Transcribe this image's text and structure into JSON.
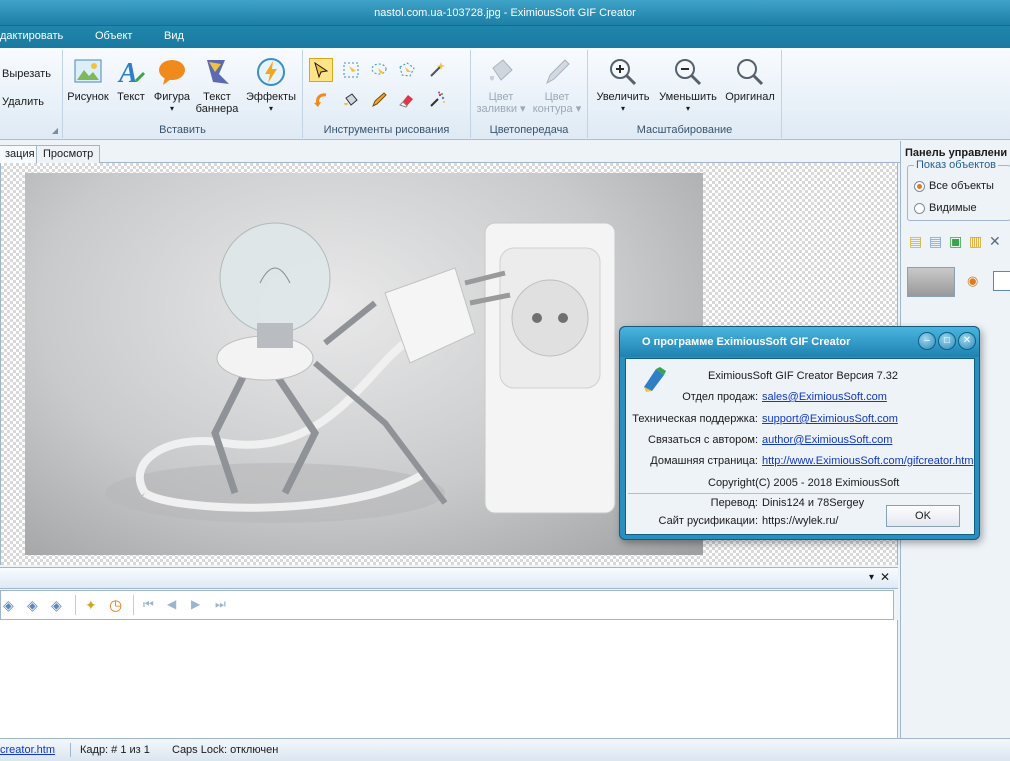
{
  "window": {
    "title": "nastol.com.ua-103728.jpg - EximiousSoft GIF Creator"
  },
  "menu": {
    "items": [
      "дактировать",
      "Объект",
      "Вид"
    ]
  },
  "ribbon": {
    "clipboard": {
      "cut": "Вырезать",
      "delete": "Удалить"
    },
    "insert": {
      "label": "Вставить",
      "picture": "Рисунок",
      "text": "Текст",
      "shape": "Фигура",
      "banner_line1": "Текст",
      "banner_line2": "баннера",
      "effects": "Эффекты"
    },
    "drawing": {
      "label": "Инструменты рисования"
    },
    "color": {
      "label": "Цветопередача",
      "fill_line1": "Цвет",
      "fill_line2": "заливки",
      "stroke_line1": "Цвет",
      "stroke_line2": "контура"
    },
    "zoom": {
      "label": "Масштабирование",
      "zoom_in": "Увеличить",
      "zoom_out": "Уменьшить",
      "original": "Оригинал"
    }
  },
  "tabs": [
    "зация",
    "Просмотр"
  ],
  "right_panel": {
    "title": "Панель управлени",
    "legend": "Показ объектов",
    "all_objects": "Все объекты",
    "visible": "Видимые"
  },
  "dialog": {
    "title": "О программе EximiousSoft GIF Creator",
    "version_line": "EximiousSoft GIF Creator Версия  7.32",
    "sales_label": "Отдел продаж:",
    "sales_email": "sales@EximiousSoft.com",
    "support_label": "Техническая поддержка:",
    "support_email": "support@EximiousSoft.com",
    "author_label": "Связаться с автором:",
    "author_email": "author@EximiousSoft.com",
    "home_label": "Домашняя страница:",
    "home_url": "http://www.EximiousSoft.com/gifcreator.htm",
    "copyright": "Copyright(C) 2005 - 2018  EximiousSoft",
    "translation_label": "Перевод:",
    "translation_value": "Dinis124 и 78Sergey",
    "ru_site_label": "Сайт русификации:",
    "ru_site_value": "https://wylek.ru/",
    "ok": "OK"
  },
  "status": {
    "link": "creator.htm",
    "frame": "Кадр: # 1 из 1",
    "capslock": "Caps Lock: отключен"
  }
}
